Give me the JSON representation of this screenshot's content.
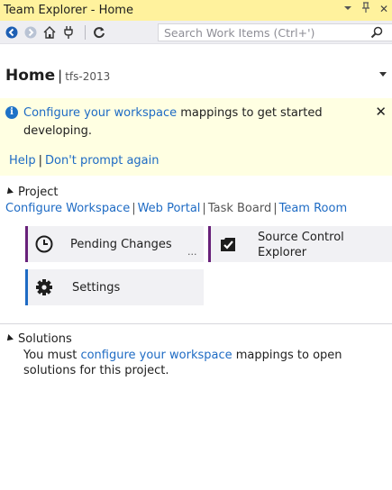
{
  "window": {
    "title": "Team Explorer - Home",
    "pin_glyph": "↓",
    "close_glyph": "✕"
  },
  "toolbar": {
    "search_placeholder": "Search Work Items (Ctrl+')"
  },
  "home": {
    "title": "Home",
    "separator": "|",
    "server": "tfs-2013"
  },
  "banner": {
    "info_glyph": "i",
    "link_text": "Configure your workspace",
    "text_rest": " mappings to get started developing.",
    "close_glyph": "✕",
    "help_label": "Help",
    "separator": "|",
    "dont_prompt_label": "Don't prompt again"
  },
  "project": {
    "header": "Project",
    "links": [
      {
        "label": "Configure Workspace"
      },
      {
        "label": "Web Portal"
      },
      {
        "label": "Task Board"
      },
      {
        "label": "Team Room"
      }
    ],
    "separator": "|",
    "tiles": {
      "pending": {
        "label": "Pending Changes",
        "more": "...",
        "accent": "#68217a"
      },
      "source_control": {
        "label": "Source Control Explorer",
        "accent": "#68217a"
      },
      "settings": {
        "label": "Settings",
        "accent": "#1e6bc4"
      }
    }
  },
  "solutions": {
    "header": "Solutions",
    "text_before": "You must ",
    "link_text": "configure your workspace",
    "text_after": " mappings to open solutions for this project."
  },
  "colors": {
    "title_bg": "#fff29d",
    "banner_bg": "#ffffe2",
    "link": "#1e6bc4"
  }
}
